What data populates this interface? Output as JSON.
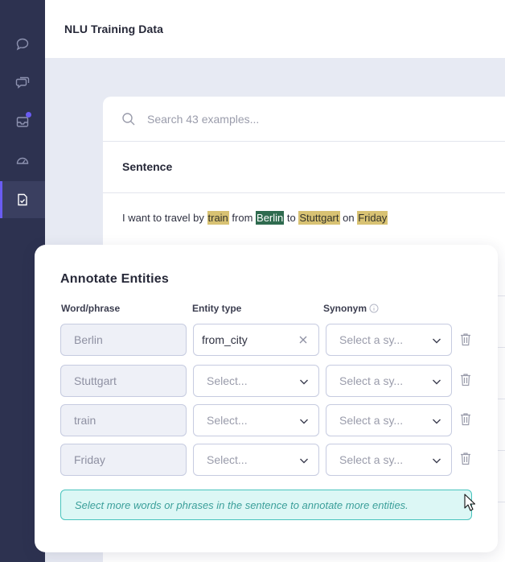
{
  "app": {
    "title": "NLU Training Data"
  },
  "sidebar": {
    "items": [
      {
        "icon": "chat-bubble-icon"
      },
      {
        "icon": "conversations-icon"
      },
      {
        "icon": "inbox-icon",
        "badge": true
      },
      {
        "icon": "dashboard-gauge-icon"
      },
      {
        "icon": "training-data-icon",
        "active": true
      }
    ]
  },
  "search": {
    "placeholder": "Search 43 examples..."
  },
  "table": {
    "column_header": "Sentence",
    "sentence": {
      "t1": "I want to travel by ",
      "e1": "train",
      "t2": " from ",
      "e2": "Berlin",
      "t3": " to ",
      "e3": "Stuttgart",
      "t4": " on ",
      "e4": "Friday"
    }
  },
  "annotate": {
    "title": "Annotate Entities",
    "columns": {
      "word": "Word/phrase",
      "entity": "Entity type",
      "synonym": "Synonym"
    },
    "rows": [
      {
        "phrase": "Berlin",
        "entity": "from_city",
        "synonym": "Select a sy..."
      },
      {
        "phrase": "Stuttgart",
        "entity": "Select...",
        "synonym": "Select a sy..."
      },
      {
        "phrase": "train",
        "entity": "Select...",
        "synonym": "Select a sy..."
      },
      {
        "phrase": "Friday",
        "entity": "Select...",
        "synonym": "Select a sy..."
      }
    ],
    "hint": "Select more words or phrases in the sentence to annotate more entities."
  },
  "colors": {
    "sidebar": "#2d3250",
    "accent": "#6a5cf2",
    "entity_highlight": "#d8c273",
    "selected_entity": "#2f6b4f",
    "hint_bg": "#dcf7f5",
    "hint_text": "#3b9f9a"
  }
}
